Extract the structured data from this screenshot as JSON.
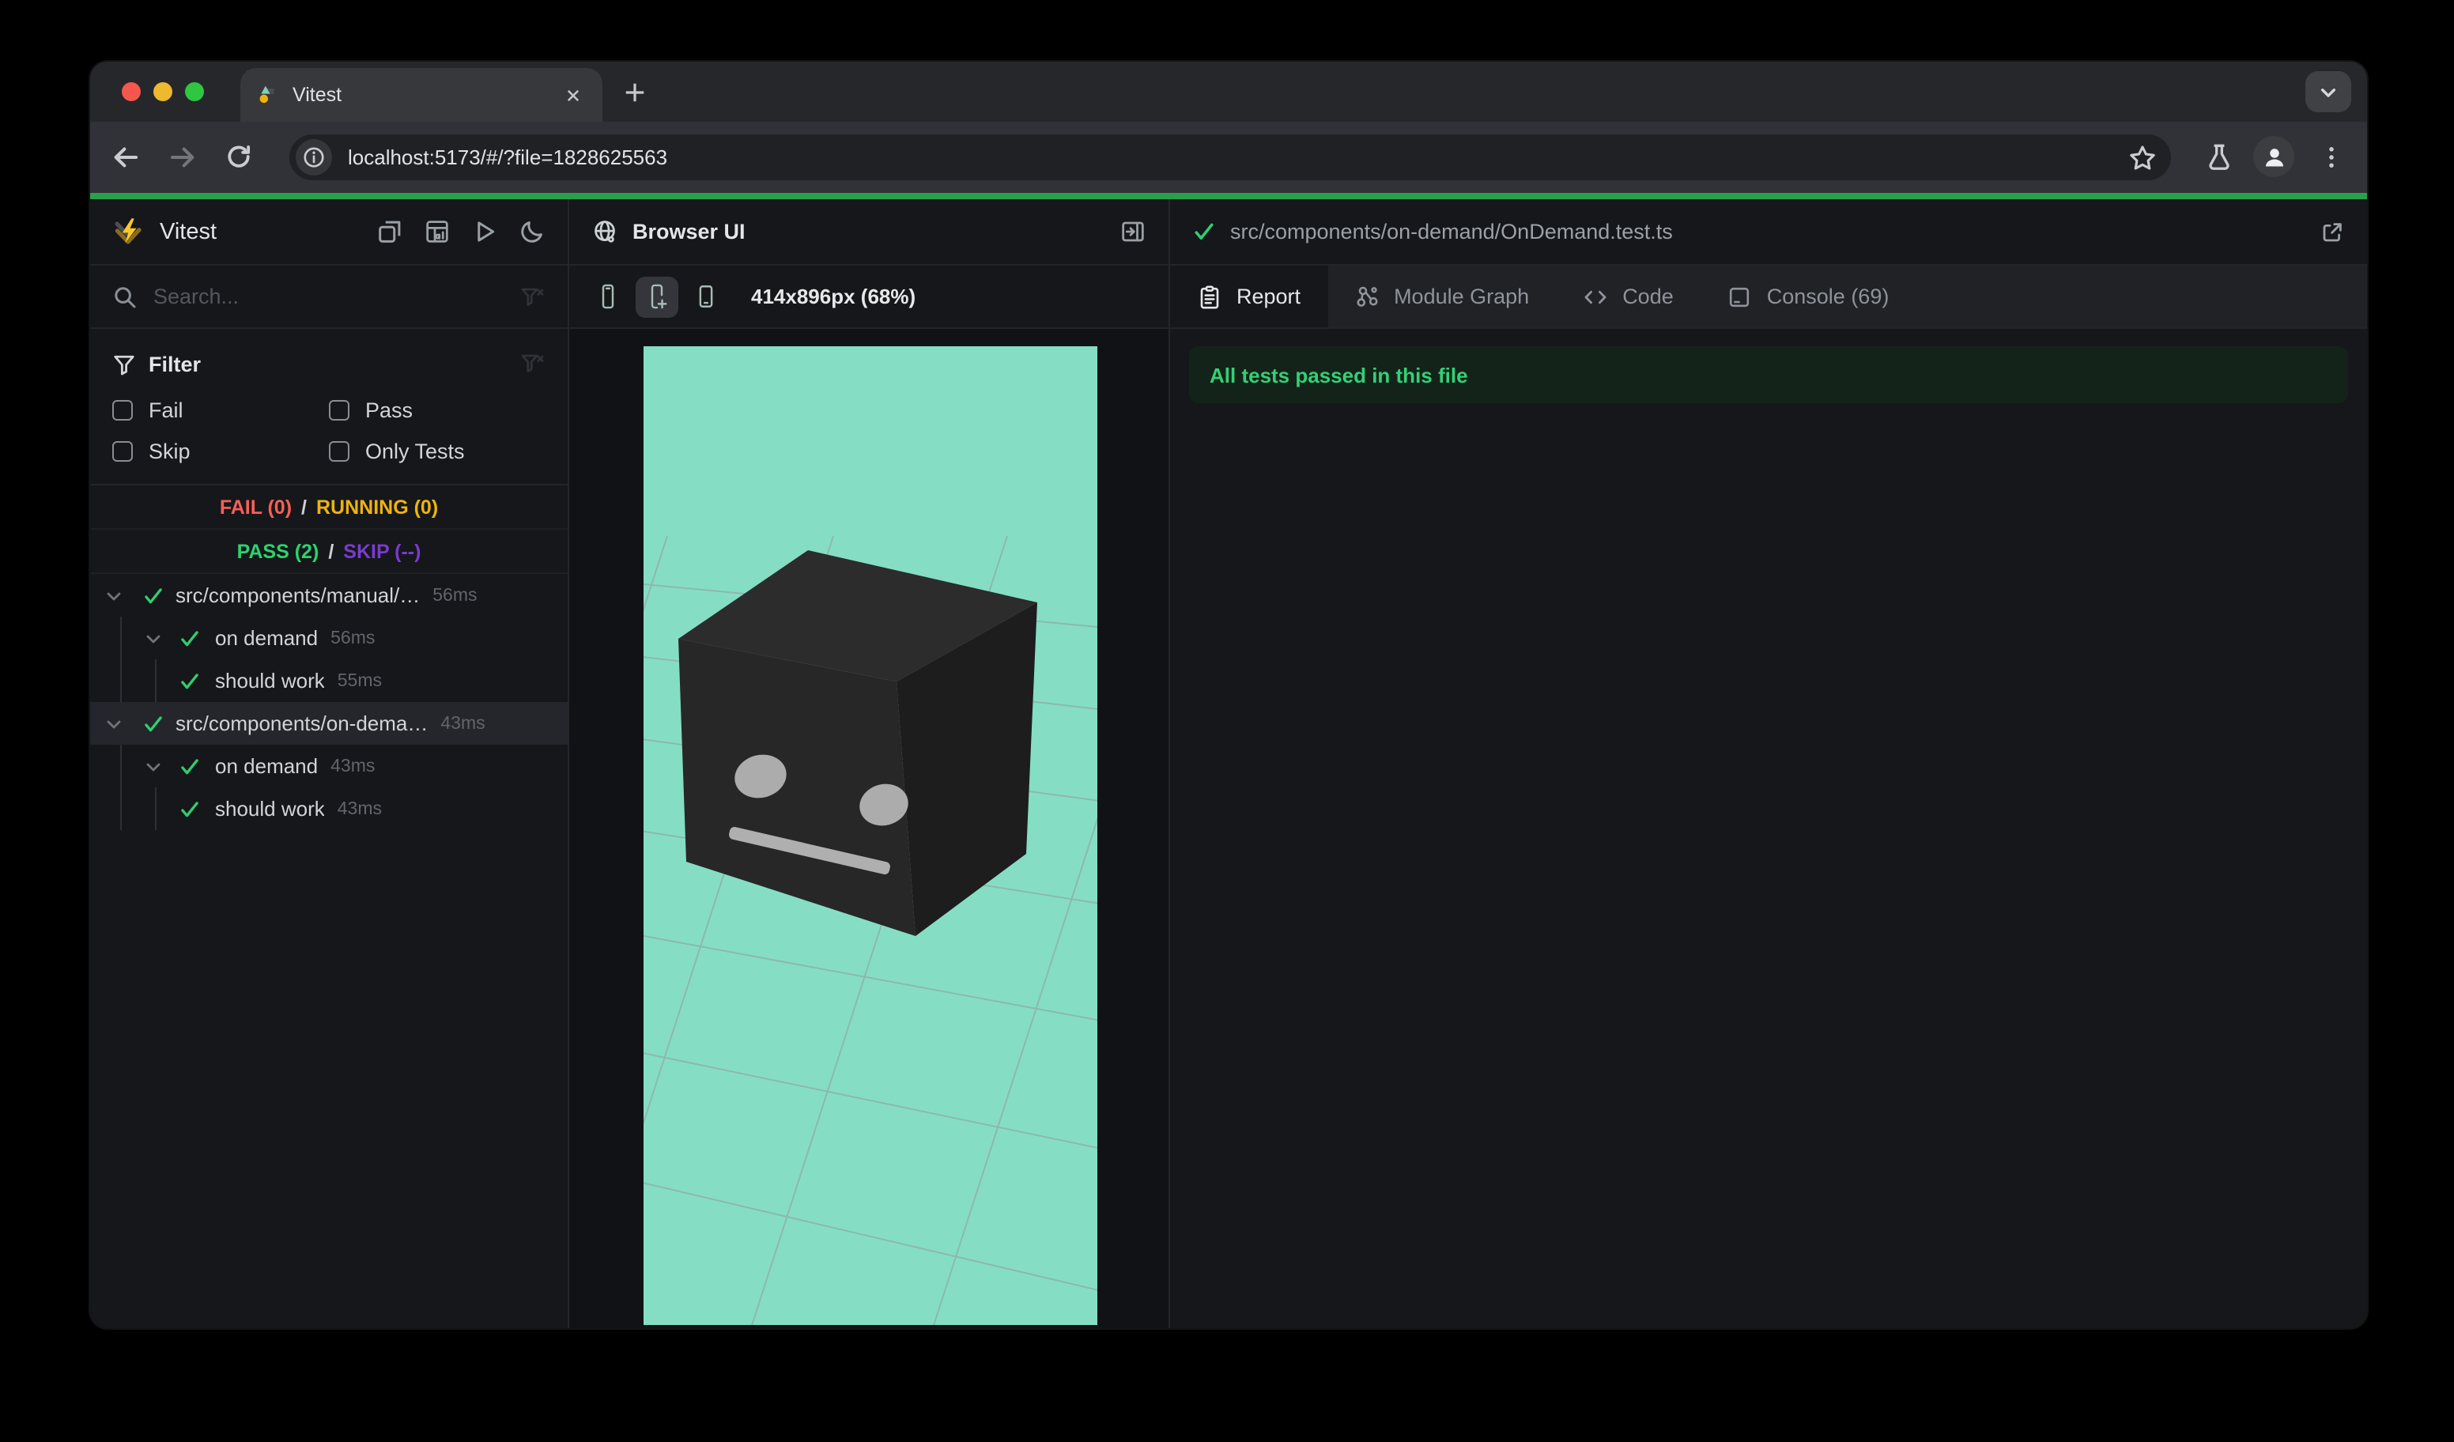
{
  "browser": {
    "tab_title": "Vitest",
    "url": "localhost:5173/#/?file=1828625563"
  },
  "sidebar": {
    "title": "Vitest",
    "search_placeholder": "Search...",
    "filter_title": "Filter",
    "filters": [
      {
        "label": "Fail"
      },
      {
        "label": "Pass"
      },
      {
        "label": "Skip"
      },
      {
        "label": "Only Tests"
      }
    ],
    "summary": {
      "fail": "FAIL (0)",
      "running": "RUNNING (0)",
      "pass": "PASS (2)",
      "skip": "SKIP (--)",
      "separator": "/"
    },
    "tree": [
      {
        "label": "src/components/manual/…",
        "duration": "56ms"
      },
      {
        "label": "on demand",
        "duration": "56ms"
      },
      {
        "label": "should work",
        "duration": "55ms"
      },
      {
        "label": "src/components/on-dema…",
        "duration": "43ms"
      },
      {
        "label": "on demand",
        "duration": "43ms"
      },
      {
        "label": "should work",
        "duration": "43ms"
      }
    ]
  },
  "preview": {
    "title": "Browser UI",
    "viewport_label": "414x896px (68%)"
  },
  "results": {
    "file_path": "src/components/on-demand/OnDemand.test.ts",
    "tabs": [
      {
        "label": "Report"
      },
      {
        "label": "Module Graph"
      },
      {
        "label": "Code"
      },
      {
        "label": "Console (69)"
      }
    ],
    "banner": "All tests passed in this file"
  },
  "colors": {
    "accent_green": "#2fce6f",
    "fail_red": "#f56058",
    "running_amber": "#edb40e",
    "pass_green": "#2dd36f",
    "skip_purple": "#7a3bcf",
    "mint": "#85dec4",
    "banner_bg": "#142319",
    "banner_text": "#32d175",
    "green_bar": "#27a24b"
  }
}
